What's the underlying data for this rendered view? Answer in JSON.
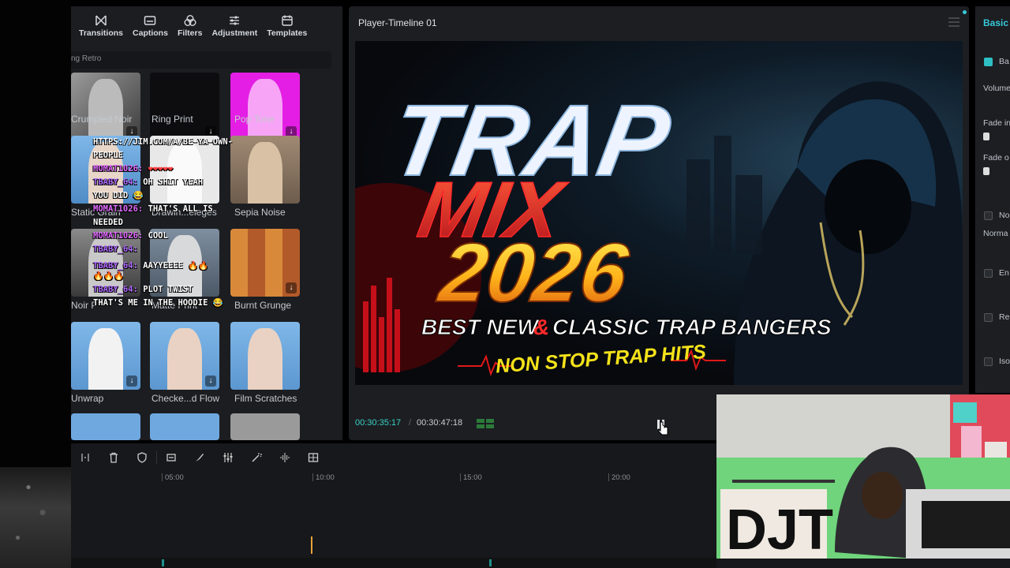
{
  "toolbar": {
    "items": [
      {
        "label": "Transitions",
        "icon": "transitions-icon"
      },
      {
        "label": "Captions",
        "icon": "captions-icon"
      },
      {
        "label": "Filters",
        "icon": "filters-icon"
      },
      {
        "label": "Adjustment",
        "icon": "adjustment-icon"
      },
      {
        "label": "Templates",
        "icon": "templates-icon"
      }
    ]
  },
  "search": {
    "value": "ng Retro"
  },
  "filters": {
    "tiles": [
      {
        "label": "Crumpled Noir"
      },
      {
        "label": "Ring Print"
      },
      {
        "label": "Pop Tone"
      },
      {
        "label": "Static Grain"
      },
      {
        "label": "Drawin...eleges"
      },
      {
        "label": "Sepia Noise"
      },
      {
        "label": "Noir P"
      },
      {
        "label": "Matte Print"
      },
      {
        "label": "Burnt Grunge"
      },
      {
        "label": "Unwrap"
      },
      {
        "label": "Checke...d Flow"
      },
      {
        "label": "Film Scratches"
      }
    ]
  },
  "chat": {
    "lines": [
      {
        "text": "HTTPS://JIM.COM/A/BE-YA-OWN-"
      },
      {
        "text": "PEOPLE"
      },
      {
        "user": "MOMAT1026:",
        "text": " ❤❤❤❤❤"
      },
      {
        "user": "TBABY_64:",
        "text": " OH SHIT YEAH"
      },
      {
        "text": "YOU DID 😂"
      },
      {
        "user": "MOMAT1026:",
        "text": " THAT'S ALL IS"
      },
      {
        "text": "NEEDED"
      },
      {
        "user": "MOMAT1026:",
        "text": " COOL"
      },
      {
        "user": "TBABY_64:",
        "text": ""
      },
      {
        "user": "TBABY_64:",
        "text": " AAYYEEEE 🔥🔥"
      },
      {
        "text": "🔥🔥🔥"
      },
      {
        "user": "TBABY_64:",
        "text": " PLOT TWIST"
      },
      {
        "text": "THAT'S ME IN THE HOODIE 😂"
      }
    ]
  },
  "player": {
    "title": "Player-Timeline 01",
    "time_current": "00:30:35:17",
    "time_total": "00:30:47:18"
  },
  "video": {
    "line1": "TRAP",
    "line2": "MIX",
    "line3": "2026",
    "tagline_a": "BEST NEW",
    "tagline_amp": "&",
    "tagline_b": "CLASSIC TRAP BANGERS",
    "subtag": "NON STOP TRAP HITS"
  },
  "right_panel": {
    "tab": "Basic",
    "items": [
      "Ba",
      "Volume",
      "Fade in",
      "Fade o",
      "No",
      "Norma",
      "En",
      "Re",
      "Iso"
    ]
  },
  "timeline": {
    "ticks": [
      "05:00",
      "10:00",
      "15:00",
      "20:00"
    ]
  },
  "webcam": {
    "sign": "DJT"
  },
  "colors": {
    "accent": "#3ad3c5",
    "playhead": "#e8a23a",
    "chat_user": "#e26bff"
  }
}
